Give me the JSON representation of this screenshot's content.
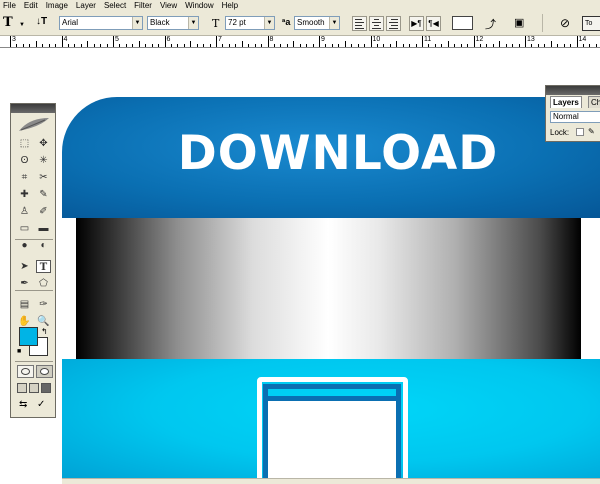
{
  "menu": [
    "File",
    "Edit",
    "Image",
    "Layer",
    "Select",
    "Filter",
    "View",
    "Window",
    "Help"
  ],
  "options_bar": {
    "tool_glyph": "T",
    "orientation_glyph": "↓T",
    "font_family": "Arial",
    "font_style": "Black",
    "font_size_glyph": "T",
    "font_size": "72 pt",
    "aa_glyph": "ªa",
    "antialias": "Smooth",
    "text_color": "#ffffff",
    "cancel_glyph": "⊘",
    "to_label": "To"
  },
  "ruler_numbers": [
    "3",
    "4",
    "5",
    "6",
    "7",
    "8",
    "9",
    "10",
    "11",
    "12",
    "13",
    "14"
  ],
  "artwork": {
    "title": "DOWNLOAD",
    "top_color": "#0a6fb2",
    "bottom_color": "#00c7ef",
    "band": "silver gradient"
  },
  "tools": {
    "selected_tool": "T",
    "foreground_color": "#00b4e6",
    "background_color": "#ffffff",
    "icons": [
      "marquee-icon",
      "move-icon",
      "lasso-icon",
      "magic-wand-icon",
      "crop-icon",
      "slice-icon",
      "healing-brush-icon",
      "brush-icon",
      "clone-stamp-icon",
      "history-brush-icon",
      "eraser-icon",
      "gradient-icon",
      "blur-icon",
      "dodge-icon",
      "path-select-icon",
      "type-icon",
      "pen-icon",
      "shape-icon",
      "notes-icon",
      "eyedropper-icon",
      "hand-icon",
      "zoom-icon"
    ]
  },
  "layers_panel": {
    "tab_active": "Layers",
    "tab_other": "Ch",
    "blend_mode": "Normal",
    "lock_label": "Lock:"
  }
}
